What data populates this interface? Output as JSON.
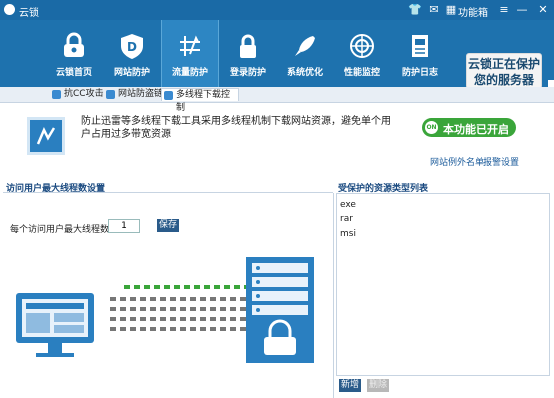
{
  "window": {
    "title": "云锁",
    "func_label": "功能箱"
  },
  "nav": [
    {
      "label": "云锁首页",
      "icon": "lock-icon"
    },
    {
      "label": "网站防护",
      "icon": "shield-d-icon"
    },
    {
      "label": "流量防护",
      "icon": "traffic-icon"
    },
    {
      "label": "登录防护",
      "icon": "padlock-icon"
    },
    {
      "label": "系统优化",
      "icon": "rocket-icon"
    },
    {
      "label": "性能监控",
      "icon": "radar-icon"
    },
    {
      "label": "防护日志",
      "icon": "log-icon"
    }
  ],
  "nav_active_index": 2,
  "status_badge": {
    "line1": "云锁正在保护",
    "line2": "您的服务器"
  },
  "subtabs": [
    {
      "label": "抗CC攻击"
    },
    {
      "label": "网站防盗链"
    },
    {
      "label": "多线程下载控制"
    }
  ],
  "feature": {
    "description": "防止迅雷等多线程下载工具采用多线程机制下载网站资源，避免单个用户占用过多带宽资源",
    "toggle_label": "本功能已开启",
    "toggle_on_text": "ON",
    "links": {
      "exceptions": "网站例外名单",
      "report": "报警设置"
    }
  },
  "settings": {
    "section_title": "访问用户最大线程数设置",
    "field_label": "每个访问用户最大线程数",
    "field_value": "1",
    "save_label": "保存"
  },
  "resources": {
    "section_title": "受保护的资源类型列表",
    "items": [
      "exe",
      "rar",
      "msi"
    ],
    "add_label": "新增",
    "delete_label": "删除"
  },
  "colors": {
    "accent": "#1e72ae",
    "toggle_on": "#3aa53a",
    "button": "#2a5b8a"
  }
}
